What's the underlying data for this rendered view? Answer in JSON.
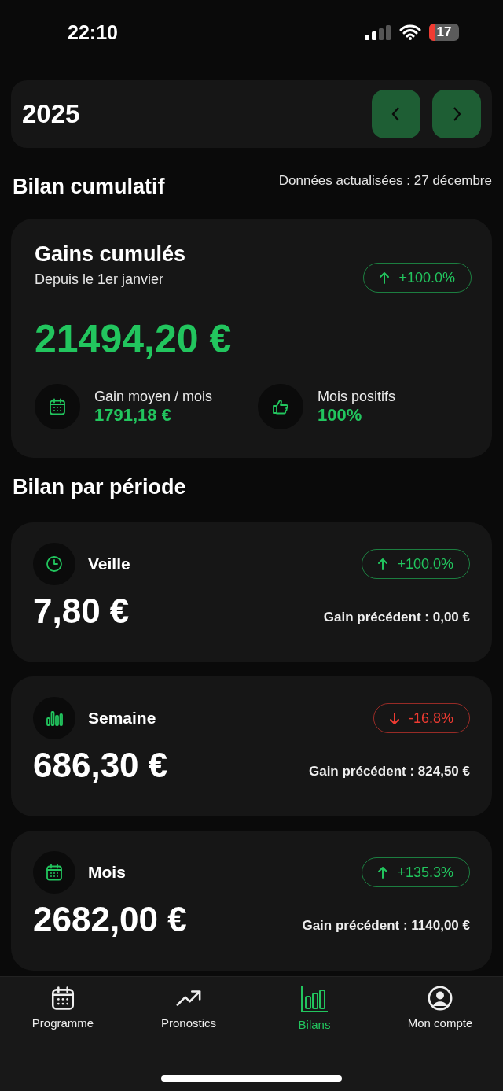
{
  "status_bar": {
    "time": "22:10",
    "battery": "17"
  },
  "year_bar": {
    "year": "2025"
  },
  "cumulative": {
    "title": "Bilan cumulatif",
    "updated": "Données actualisées : 27 décembre",
    "card": {
      "title": "Gains cumulés",
      "subtitle": "Depuis le 1er janvier",
      "trend": {
        "kind": "up",
        "label": "+100.0%"
      },
      "amount": "21494,20 €",
      "stats": [
        {
          "kind": "calendar",
          "label": "Gain moyen / mois",
          "value": "1791,18 €"
        },
        {
          "kind": "thumb",
          "label": "Mois positifs",
          "value": "100%"
        }
      ]
    }
  },
  "periods": {
    "title": "Bilan par période",
    "items": [
      {
        "kind": "clock",
        "name": "Veille",
        "trend": {
          "kind": "up",
          "label": "+100.0%"
        },
        "amount": "7,80 €",
        "previous": "Gain précédent : 0,00 €"
      },
      {
        "kind": "bars",
        "name": "Semaine",
        "trend": {
          "kind": "down",
          "label": "-16.8%"
        },
        "amount": "686,30 €",
        "previous": "Gain précédent : 824,50 €"
      },
      {
        "kind": "calendar",
        "name": "Mois",
        "trend": {
          "kind": "up",
          "label": "+135.3%"
        },
        "amount": "2682,00 €",
        "previous": "Gain précédent : 1140,00 €"
      }
    ]
  },
  "tab_bar": [
    {
      "kind": "calendar",
      "label": "Programme",
      "selected": false
    },
    {
      "kind": "trend",
      "label": "Pronostics",
      "selected": false
    },
    {
      "kind": "bars",
      "label": "Bilans",
      "selected": true
    },
    {
      "kind": "user",
      "label": "Mon compte",
      "selected": false
    }
  ]
}
